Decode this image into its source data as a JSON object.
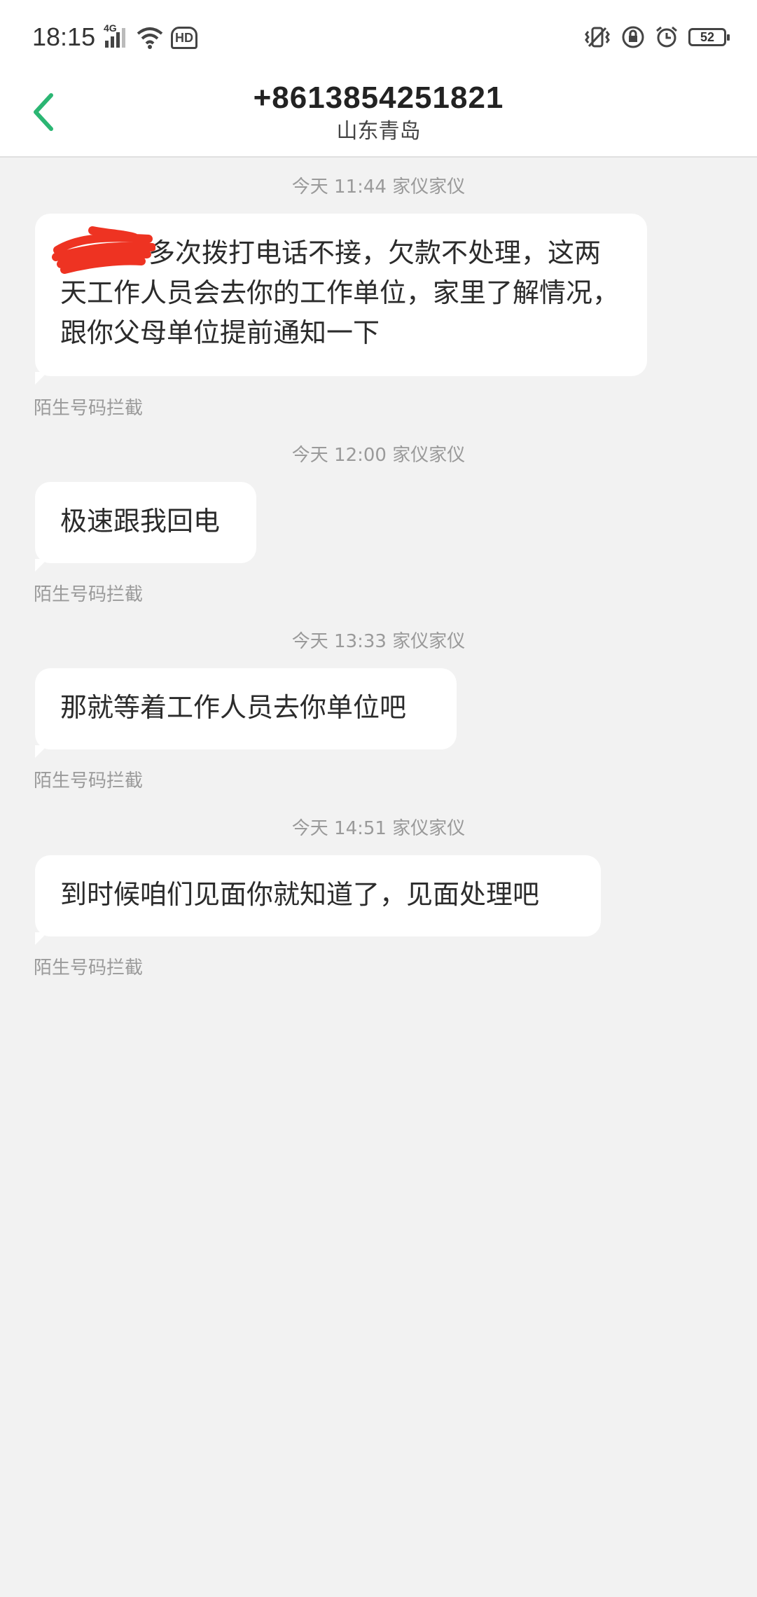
{
  "status_bar": {
    "time": "18:15",
    "network": "4G",
    "hd_label": "HD",
    "battery_level": "52"
  },
  "header": {
    "contact_number": "+8613854251821",
    "contact_location": "山东青岛",
    "accent_color": "#2bb673"
  },
  "messages": [
    {
      "timestamp": "今天 11:44  家仪家仪",
      "text": "，多次拨打电话不接，欠款不处理，这两天工作人员会去你的工作单位，家里了解情况，跟你父母单位提前通知一下",
      "redacted_prefix": true,
      "note": "陌生号码拦截"
    },
    {
      "timestamp": "今天 12:00  家仪家仪",
      "text": "极速跟我回电",
      "note": "陌生号码拦截"
    },
    {
      "timestamp": "今天 13:33  家仪家仪",
      "text": "那就等着工作人员去你单位吧",
      "note": "陌生号码拦截"
    },
    {
      "timestamp": "今天 14:51  家仪家仪",
      "text": "到时候咱们见面你就知道了，见面处理吧",
      "note": "陌生号码拦截"
    }
  ]
}
